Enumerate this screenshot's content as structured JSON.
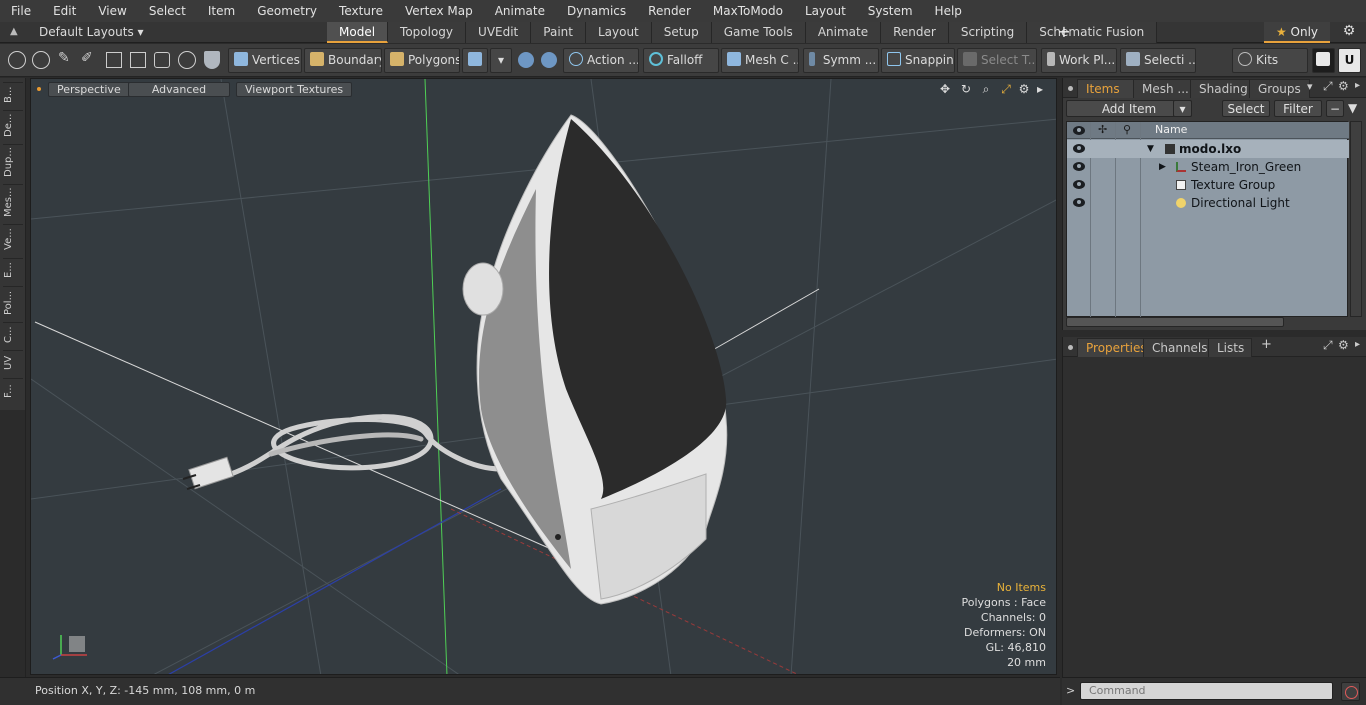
{
  "menu": [
    "File",
    "Edit",
    "View",
    "Select",
    "Item",
    "Geometry",
    "Texture",
    "Vertex Map",
    "Animate",
    "Dynamics",
    "Render",
    "MaxToModo",
    "Layout",
    "System",
    "Help"
  ],
  "layoutbar": {
    "layout_selector": "Default Layouts ▾",
    "tabs": [
      "Model",
      "Topology",
      "UVEdit",
      "Paint",
      "Layout",
      "Setup",
      "Game Tools",
      "Animate",
      "Render",
      "Scripting",
      "Schematic Fusion"
    ],
    "active_tab": "Model",
    "only_label": "Only"
  },
  "toolbar": {
    "vertices": "Vertices",
    "boundary": "Boundary",
    "polygons": "Polygons",
    "action": "Action",
    "falloff": "Falloff",
    "mesh": "Mesh C ...",
    "symmetry": "Symm ...",
    "snapping": "Snapping",
    "select_t": "Select T...",
    "work_plane": "Work Pl...",
    "selection": "Selecti ...",
    "kits": "Kits"
  },
  "leftstrip": [
    "B...",
    "De...",
    "Dup...",
    "Mes...",
    "Ve...",
    "E...",
    "Pol...",
    "C...",
    "UV",
    "F..."
  ],
  "viewport": {
    "perspective": "Perspective",
    "advanced": "Advanced",
    "textures": "Viewport Textures",
    "stats": {
      "no_items": "No Items",
      "polygons": "Polygons : Face",
      "channels": "Channels: 0",
      "deformers": "Deformers: ON",
      "gl": "GL: 46,810",
      "scale": "20 mm"
    }
  },
  "status": {
    "position": "Position X, Y, Z:  -145 mm, 108 mm, 0 m"
  },
  "items_panel": {
    "tabs": [
      "Items",
      "Mesh ...",
      "Shading",
      "Groups"
    ],
    "add_item": "Add Item",
    "select": "Select",
    "filter": "Filter",
    "name_header": "Name",
    "rows": [
      {
        "name": "modo.lxo"
      },
      {
        "name": "Steam_Iron_Green"
      },
      {
        "name": "Texture Group"
      },
      {
        "name": "Directional Light"
      }
    ]
  },
  "props_panel": {
    "tabs": [
      "Properties",
      "Channels",
      "Lists"
    ]
  },
  "command": {
    "placeholder": "Command"
  },
  "colors": {
    "accent": "#e8a23c",
    "viewport_bg": "#343b40"
  }
}
